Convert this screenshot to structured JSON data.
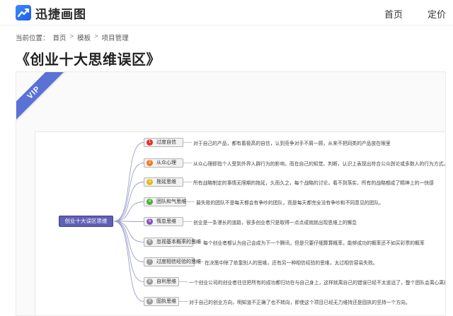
{
  "header": {
    "logo_text": "迅捷画图",
    "nav": {
      "home": "首页",
      "pricing": "定价"
    }
  },
  "breadcrumb": {
    "label": "当前位置：",
    "items": [
      "首页",
      "模板",
      "项目管理"
    ],
    "separator": ">"
  },
  "page_title": "《创业十大思维误区》",
  "badge": {
    "text": "VIP",
    "color": "#5a72d6"
  },
  "mindmap": {
    "root": "创业十大误区思维",
    "branches": [
      {
        "num": "1",
        "label": "过度自信",
        "color": "#e2322a",
        "desc": "对于自己的产品，都有着极高的自信，认到竞争对手不屑一顾，从来不把同类的产品放在眼里"
      },
      {
        "num": "2",
        "label": "从众心理",
        "color": "#f07a1a",
        "desc": "从众心理即指个人受到外界人群行为的影响，而在自己的知觉、判断，认识上表现出符合公众舆论或多数人的行为方式。"
      },
      {
        "num": "3",
        "label": "拖延思维",
        "color": "#e8b812",
        "desc": "所有战略制定的事情无限期的拖延，久而久之，每个战略的讨论，看不到落实，所有的战略都成了精神上的一快感"
      },
      {
        "num": "4",
        "label": "团队和气思维",
        "color": "#4caf3a",
        "desc": "最失败的团队不是每天都会有争吵的团队，而是每天都完全没有争吵和不同意见的团队。"
      },
      {
        "num": "5",
        "label": "惰怠思维",
        "color": "#8a4fc4",
        "desc": "创业是一条漫长的道路，很多创业者只是取得一点点成就就出现思维上的懈怠"
      },
      {
        "num": "6",
        "label": "忽视基本概率的思维",
        "color": "#9a9a9a",
        "desc": "每个创业者都认为自己会成为下一个腾讯，但是只要仔细算算概率，能够成功的概率还不如买彩票的概率"
      },
      {
        "num": "7",
        "label": "过度相信经验的思维",
        "color": "#9a9a9a",
        "desc": "在决策中除了依靠别人的思维，还有另一种相信经验的思维，太过相信容易失败。"
      },
      {
        "num": "8",
        "label": "自利思维",
        "color": "#9a9a9a",
        "desc": "一个创业公司的创业者往往把所有的成功都归功在与自己身上，这样就离自己的错误已经不太遥远了，整个团队会离心离得。"
      },
      {
        "num": "9",
        "label": "固执思维",
        "color": "#9a9a9a",
        "desc": "对于自己的创业方向，明知道不正确了也不转向，即使这个项目已经无力维持还是固执的坚持一个方向。"
      }
    ]
  }
}
